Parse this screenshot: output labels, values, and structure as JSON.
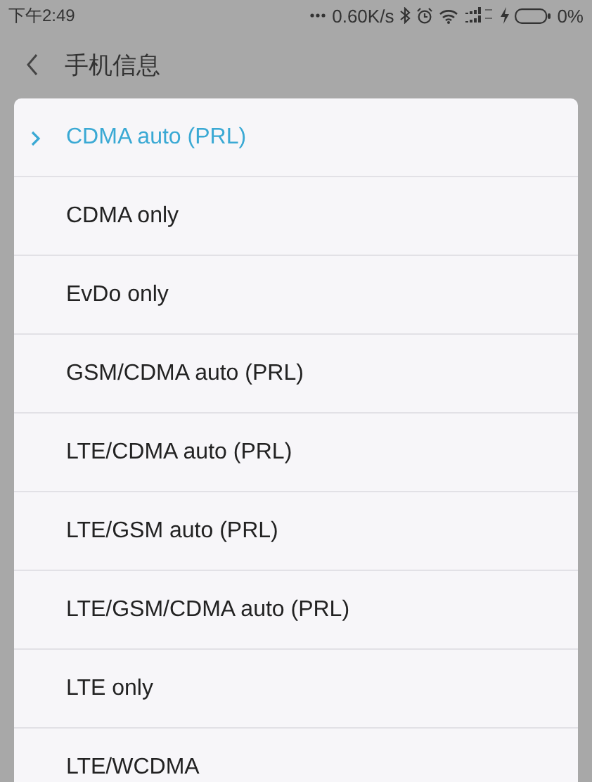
{
  "status_bar": {
    "time": "下午2:49",
    "network_speed": "0.60K/s",
    "battery": "0%"
  },
  "header": {
    "title": "手机信息"
  },
  "options": [
    {
      "label": "CDMA auto (PRL)",
      "selected": true
    },
    {
      "label": "CDMA only",
      "selected": false
    },
    {
      "label": "EvDo only",
      "selected": false
    },
    {
      "label": "GSM/CDMA auto (PRL)",
      "selected": false
    },
    {
      "label": "LTE/CDMA auto (PRL)",
      "selected": false
    },
    {
      "label": "LTE/GSM auto (PRL)",
      "selected": false
    },
    {
      "label": "LTE/GSM/CDMA auto (PRL)",
      "selected": false
    },
    {
      "label": "LTE only",
      "selected": false
    },
    {
      "label": "LTE/WCDMA",
      "selected": false
    }
  ]
}
